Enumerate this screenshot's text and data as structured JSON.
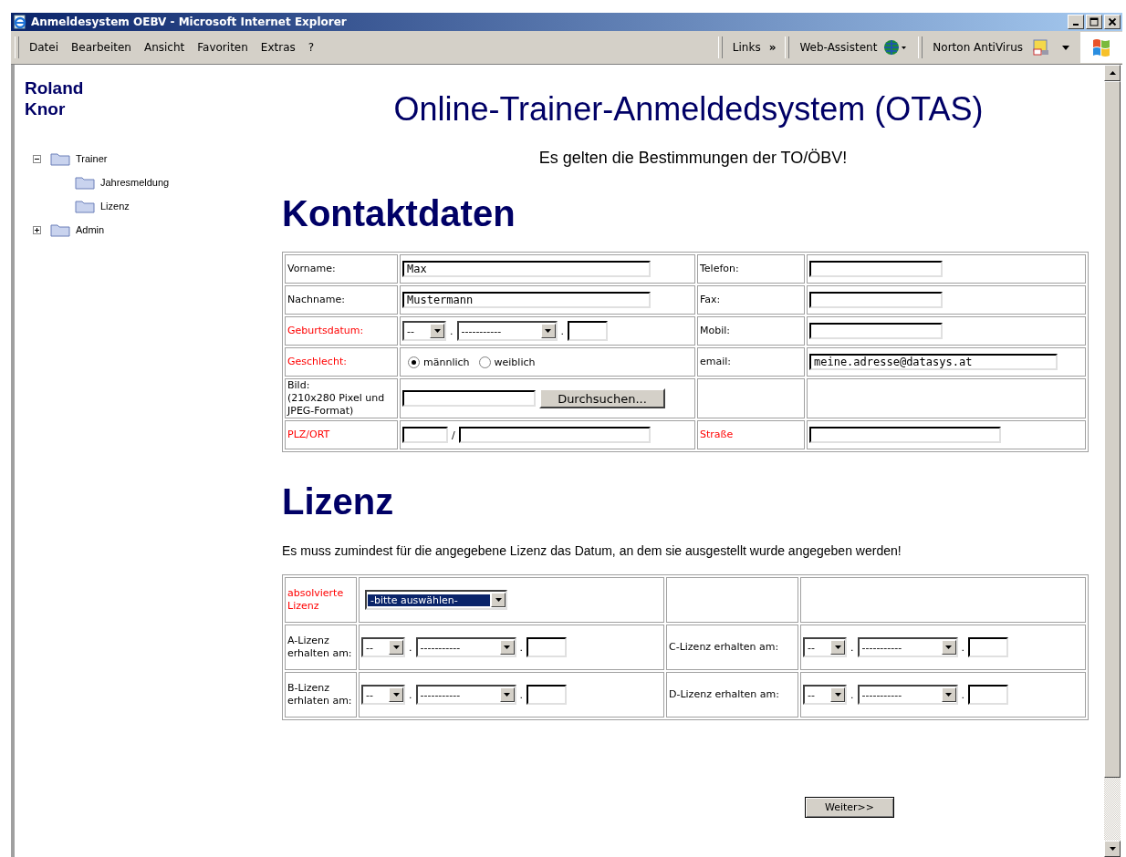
{
  "window": {
    "title": "Anmeldesystem OEBV - Microsoft Internet Explorer"
  },
  "menu": [
    "Datei",
    "Bearbeiten",
    "Ansicht",
    "Favoriten",
    "Extras",
    "?"
  ],
  "toolbar": {
    "links": "Links",
    "more": "»",
    "assistant": "Web-Assistent",
    "antivirus": "Norton AntiVirus"
  },
  "sidebar": {
    "user": "Roland Knor",
    "tree": [
      {
        "label": "Trainer",
        "expanded": true,
        "children": [
          {
            "label": "Jahresmeldung"
          },
          {
            "label": "Lizenz"
          }
        ]
      },
      {
        "label": "Admin",
        "expanded": false
      }
    ]
  },
  "page": {
    "title": "Online-Trainer-Anmeldedsystem (OTAS)",
    "notice": "Es gelten die Bestimmungen der TO/ÖBV!",
    "contact_heading": "Kontaktdaten",
    "contact_rows": [
      [
        {
          "kind": "label",
          "text": "Vorname:",
          "required": false
        },
        {
          "kind": "text",
          "value": "Max"
        },
        {
          "kind": "label",
          "text": "Telefon:",
          "required": false
        },
        {
          "kind": "text"
        }
      ],
      [
        {
          "kind": "label",
          "text": "Nachname:",
          "required": false
        },
        {
          "kind": "text",
          "value": "Mustermann"
        },
        {
          "kind": "label",
          "text": "Fax:",
          "required": false
        },
        {
          "kind": "text"
        }
      ],
      [
        {
          "kind": "label",
          "text": "Geburtsdatum:",
          "required": true
        },
        {
          "kind": "date",
          "day": "--",
          "month": "-----------",
          "separator": "."
        },
        {
          "kind": "label",
          "text": "Mobil:",
          "required": false
        },
        {
          "kind": "text"
        }
      ],
      [
        {
          "kind": "label",
          "text": "Geschlecht:",
          "required": true
        },
        {
          "kind": "radio",
          "options": [
            {
              "label": "männlich",
              "selected": true
            },
            {
              "label": "weiblich",
              "selected": false
            }
          ]
        },
        {
          "kind": "label",
          "text": "email:",
          "required": false
        },
        {
          "kind": "email",
          "value": "meine.adresse@datasys.at"
        }
      ],
      [
        {
          "kind": "label",
          "text": "Bild:\n(210x280 Pixel und JPEG-Format)",
          "required": false
        },
        {
          "kind": "file",
          "button": "Durchsuchen..."
        },
        {
          "kind": "empty"
        },
        {
          "kind": "empty"
        }
      ],
      [
        {
          "kind": "label",
          "text": "PLZ/ORT",
          "required": true
        },
        {
          "kind": "plz",
          "separator": "/"
        },
        {
          "kind": "label",
          "text": "Straße",
          "required": true
        },
        {
          "kind": "street"
        }
      ]
    ],
    "license_heading": "Lizenz",
    "license_note": "Es muss zumindest für die angegebene Lizenz das Datum, an dem sie ausgestellt wurde angegeben werden!",
    "license_rows": [
      [
        {
          "kind": "label",
          "text": "absolvierte Lizenz",
          "required": true
        },
        {
          "kind": "select",
          "value": "-bitte auswählen-",
          "focused": true
        },
        {
          "kind": "empty"
        },
        {
          "kind": "empty"
        }
      ],
      [
        {
          "kind": "label",
          "text": "A-Lizenz erhalten am:",
          "required": false
        },
        {
          "kind": "date",
          "day": "--",
          "month": "-----------",
          "separator": "."
        },
        {
          "kind": "label",
          "text": "C-Lizenz erhalten am:",
          "required": false
        },
        {
          "kind": "date",
          "day": "--",
          "month": "-----------",
          "separator": "."
        }
      ],
      [
        {
          "kind": "label",
          "text": "B-Lizenz erhlaten am:",
          "required": false
        },
        {
          "kind": "date",
          "day": "--",
          "month": "-----------",
          "separator": "."
        },
        {
          "kind": "label",
          "text": "D-Lizenz erhalten am:",
          "required": false
        },
        {
          "kind": "date",
          "day": "--",
          "month": "-----------",
          "separator": "."
        }
      ]
    ],
    "next_button": "Weiter>>"
  }
}
